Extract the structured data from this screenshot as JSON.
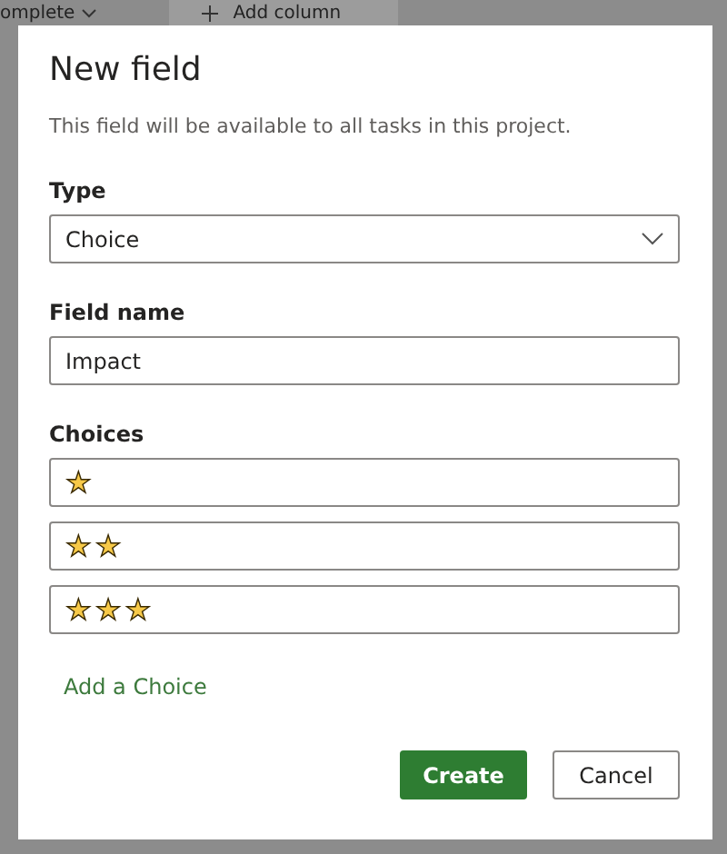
{
  "background": {
    "status_filter": "omplete",
    "add_column": "Add column"
  },
  "dialog": {
    "title": "New field",
    "description": "This field will be available to all tasks in this project.",
    "type": {
      "label": "Type",
      "value": "Choice"
    },
    "field_name": {
      "label": "Field name",
      "value": "Impact"
    },
    "choices": {
      "label": "Choices",
      "items": [
        {
          "value": "★"
        },
        {
          "value": "★★"
        },
        {
          "value": "★★★"
        }
      ],
      "add_link": "Add a Choice"
    },
    "buttons": [
      {
        "label": "Create",
        "kind": "primary"
      },
      {
        "label": "Cancel",
        "kind": "secondary"
      }
    ]
  }
}
